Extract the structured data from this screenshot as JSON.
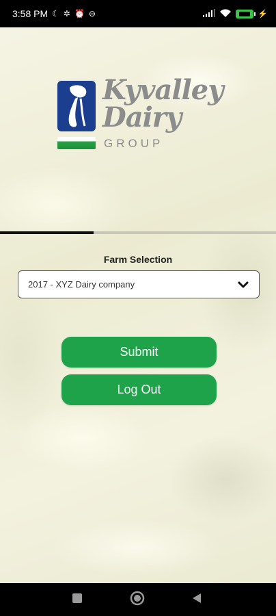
{
  "status_bar": {
    "time": "3:58 PM",
    "icons_left": [
      "moon-icon",
      "fan-icon",
      "alarm-icon",
      "dnd-icon"
    ],
    "icons_right": [
      "signal-icon",
      "wifi-icon",
      "battery-icon",
      "charging-icon"
    ]
  },
  "logo": {
    "line1": "Kyvalley",
    "line2": "Dairy",
    "line3": "GROUP",
    "colors": {
      "mark": "#1b3f8e",
      "grass": "#27a447",
      "text": "#8c8c8c"
    }
  },
  "progress": {
    "value": 0.34
  },
  "form": {
    "farm_label": "Farm Selection",
    "farm_selected": "2017 - XYZ Dairy company"
  },
  "buttons": {
    "submit": "Submit",
    "logout": "Log Out",
    "color": "#1fa34a"
  },
  "nav": {
    "icons": [
      "recent-apps-icon",
      "home-icon",
      "back-icon"
    ]
  }
}
